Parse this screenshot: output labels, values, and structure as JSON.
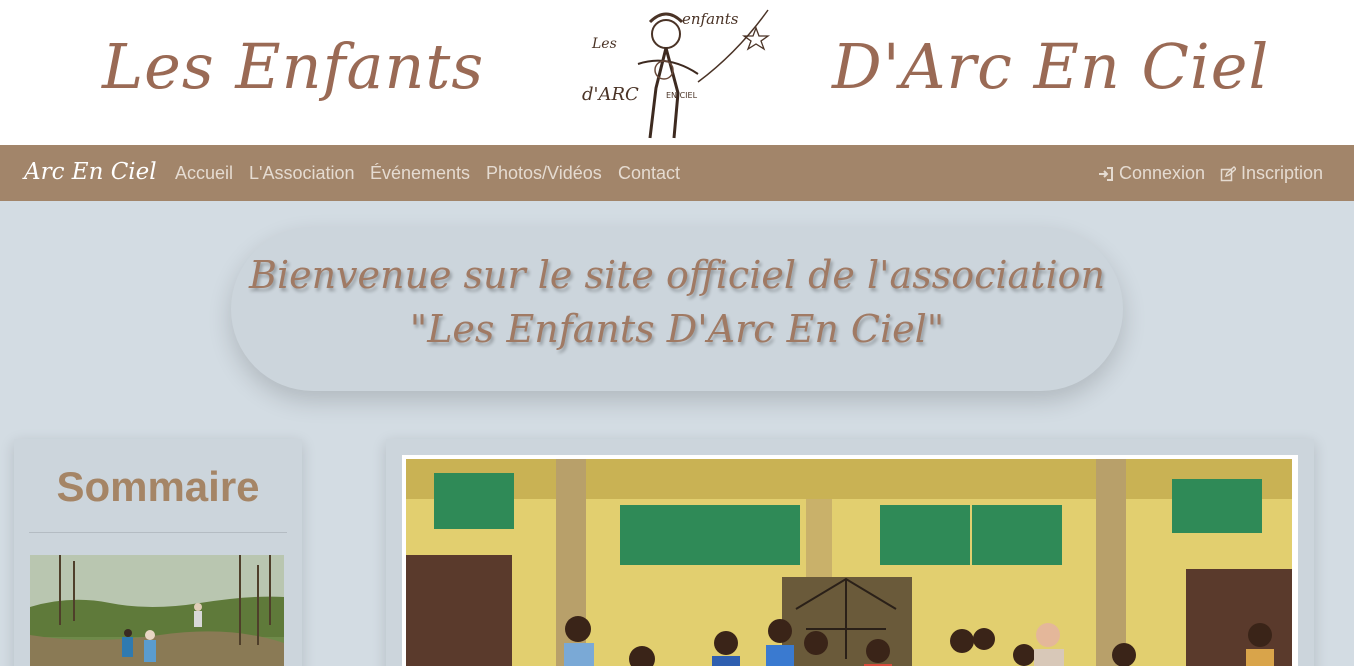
{
  "banner": {
    "title_left": "Les Enfants",
    "title_right": "D'Arc En Ciel",
    "logo_text": {
      "top": "Les",
      "mid": "enfants",
      "bottom": "d'ARC",
      "sub": "EN CIEL"
    }
  },
  "navbar": {
    "brand": "Arc En Ciel",
    "links": [
      "Accueil",
      "L'Association",
      "Événements",
      "Photos/Vidéos",
      "Contact"
    ],
    "login": {
      "label": "Connexion",
      "icon": "sign-in-icon"
    },
    "register": {
      "label": "Inscription",
      "icon": "edit-icon"
    }
  },
  "hero": {
    "line1": "Bienvenue sur le site officiel de l'association",
    "line2": "\"Les Enfants D'Arc En Ciel\""
  },
  "sidebar": {
    "title": "Sommaire"
  },
  "colors": {
    "accent": "#a2856a",
    "script": "#9a6a55",
    "background": "#d3dce3"
  }
}
